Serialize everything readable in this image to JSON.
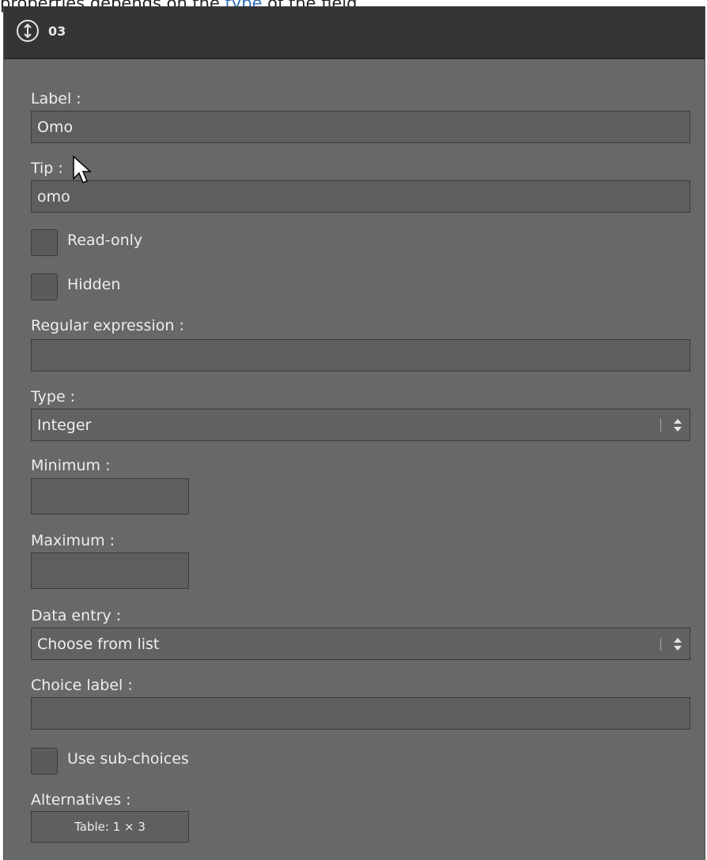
{
  "doc_text": {
    "before": "properties depends on the ",
    "link": "type",
    "after": " of the field."
  },
  "header": {
    "icon": "info-sort-icon",
    "title": "03"
  },
  "form": {
    "label": {
      "caption": "Label :",
      "value": "Omo"
    },
    "tip": {
      "caption": "Tip :",
      "value": "omo"
    },
    "read_only": {
      "caption": "Read-only",
      "checked": false
    },
    "hidden": {
      "caption": "Hidden",
      "checked": false
    },
    "regex": {
      "caption": "Regular expression :",
      "value": ""
    },
    "type": {
      "caption": "Type :",
      "value": "Integer"
    },
    "minimum": {
      "caption": "Minimum :",
      "value": ""
    },
    "maximum": {
      "caption": "Maximum :",
      "value": ""
    },
    "data_entry": {
      "caption": "Data entry :",
      "value": "Choose from list"
    },
    "choice_label": {
      "caption": "Choice label :",
      "value": ""
    },
    "sub_choices": {
      "caption": "Use sub-choices",
      "checked": false
    },
    "alternatives": {
      "caption": "Alternatives :",
      "button": "Table: 1 × 3"
    }
  },
  "colors": {
    "panel_bg": "#67686a",
    "header_bg": "#343537",
    "link": "#2e6db4"
  }
}
